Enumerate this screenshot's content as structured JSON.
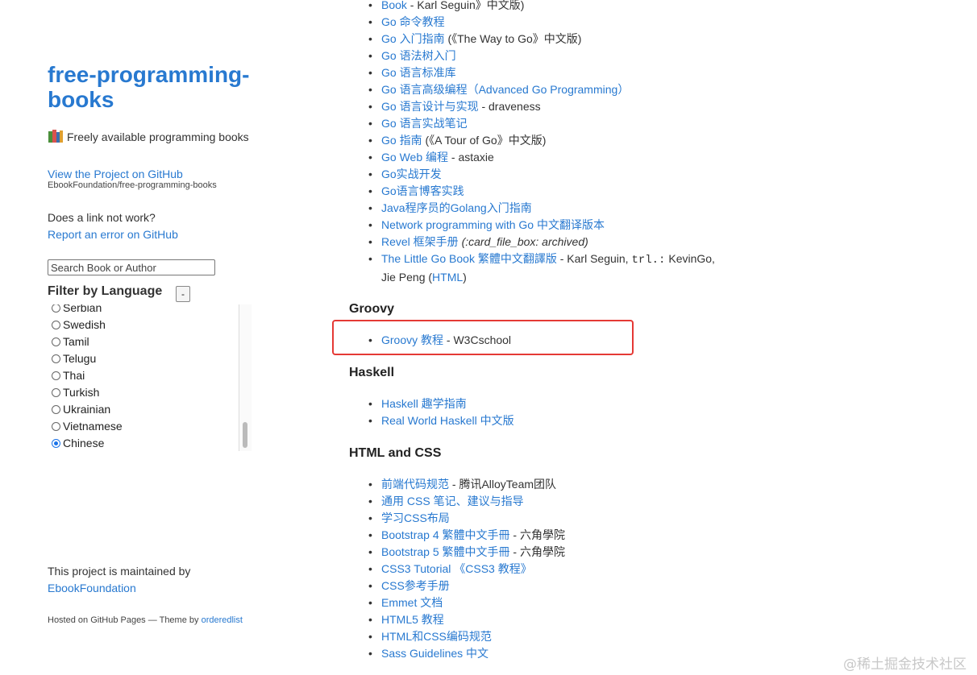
{
  "sidebar": {
    "title": "free-programming-books",
    "tagline": "Freely available programming books",
    "github_link": "View the Project on GitHub",
    "github_repo": "EbookFoundation/free-programming-books",
    "question": "Does a link not work?",
    "report_link": "Report an error on GitHub",
    "search_placeholder": "Search Book or Author",
    "filter_title": "Filter by Language",
    "filter_toggle": "-",
    "languages": [
      {
        "label": "Serbian",
        "checked": false
      },
      {
        "label": "Swedish",
        "checked": false
      },
      {
        "label": "Tamil",
        "checked": false
      },
      {
        "label": "Telugu",
        "checked": false
      },
      {
        "label": "Thai",
        "checked": false
      },
      {
        "label": "Turkish",
        "checked": false
      },
      {
        "label": "Ukrainian",
        "checked": false
      },
      {
        "label": "Vietnamese",
        "checked": false
      },
      {
        "label": "Chinese",
        "checked": true
      }
    ],
    "maintained_text": "This project is maintained by",
    "maintainer": "EbookFoundation",
    "hosted_text": "Hosted on GitHub Pages — Theme by",
    "theme_link": "orderedlist"
  },
  "main": {
    "go_items": [
      {
        "link": "Book",
        "rest": " - Karl Seguin》中文版)"
      },
      {
        "link": "Go 命令教程",
        "rest": ""
      },
      {
        "link": "Go 入门指南",
        "rest": " (《The Way to Go》中文版)"
      },
      {
        "link": "Go 语法树入门",
        "rest": ""
      },
      {
        "link": "Go 语言标准库",
        "rest": ""
      },
      {
        "link": "Go 语言高级编程（Advanced Go Programming）",
        "rest": ""
      },
      {
        "link": "Go 语言设计与实现",
        "rest": " - draveness"
      },
      {
        "link": "Go 语言实战笔记",
        "rest": ""
      },
      {
        "link": "Go 指南",
        "rest": " (《A Tour of Go》中文版)"
      },
      {
        "link": "Go Web 编程",
        "rest": " - astaxie"
      },
      {
        "link": "Go实战开发",
        "rest": ""
      },
      {
        "link": "Go语言博客实践",
        "rest": ""
      },
      {
        "link": "Java程序员的Golang入门指南",
        "rest": ""
      },
      {
        "link": "Network programming with Go 中文翻译版本",
        "rest": ""
      }
    ],
    "revel": {
      "link": "Revel 框架手册",
      "note": "(:card_file_box: archived)"
    },
    "little_go": {
      "link": "The Little Go Book 繁體中文翻譯版",
      "rest1": " - Karl Seguin, ",
      "trl": "trl.:",
      "rest2": " KevinGo, Jie Peng (",
      "html_link": "HTML",
      "rest3": ")"
    },
    "groovy_heading": "Groovy",
    "groovy_items": [
      {
        "link": "Groovy 教程",
        "rest": " - W3Cschool"
      }
    ],
    "haskell_heading": "Haskell",
    "haskell_items": [
      {
        "link": "Haskell 趣学指南",
        "rest": ""
      },
      {
        "link": "Real World Haskell 中文版",
        "rest": ""
      }
    ],
    "htmlcss_heading": "HTML and CSS",
    "htmlcss_items": [
      {
        "link": "前端代码规范",
        "rest": " - 腾讯AlloyTeam团队"
      },
      {
        "link": "通用 CSS 笔记、建议与指导",
        "rest": ""
      },
      {
        "link": "学习CSS布局",
        "rest": ""
      },
      {
        "link": "Bootstrap 4 繁體中文手冊",
        "rest": " - 六角學院"
      },
      {
        "link": "Bootstrap 5 繁體中文手冊",
        "rest": " - 六角學院"
      },
      {
        "link": "CSS3 Tutorial 《CSS3 教程》",
        "rest": ""
      },
      {
        "link": "CSS参考手册",
        "rest": ""
      },
      {
        "link": "Emmet 文档",
        "rest": ""
      },
      {
        "link": "HTML5 教程",
        "rest": ""
      },
      {
        "link": "HTML和CSS编码规范",
        "rest": ""
      },
      {
        "link": "Sass Guidelines 中文",
        "rest": ""
      }
    ]
  },
  "watermark": "@稀土掘金技术社区",
  "colors": {
    "link": "#2879d0",
    "highlight_border": "#e53935",
    "radio_checked": "#1a73e8"
  }
}
